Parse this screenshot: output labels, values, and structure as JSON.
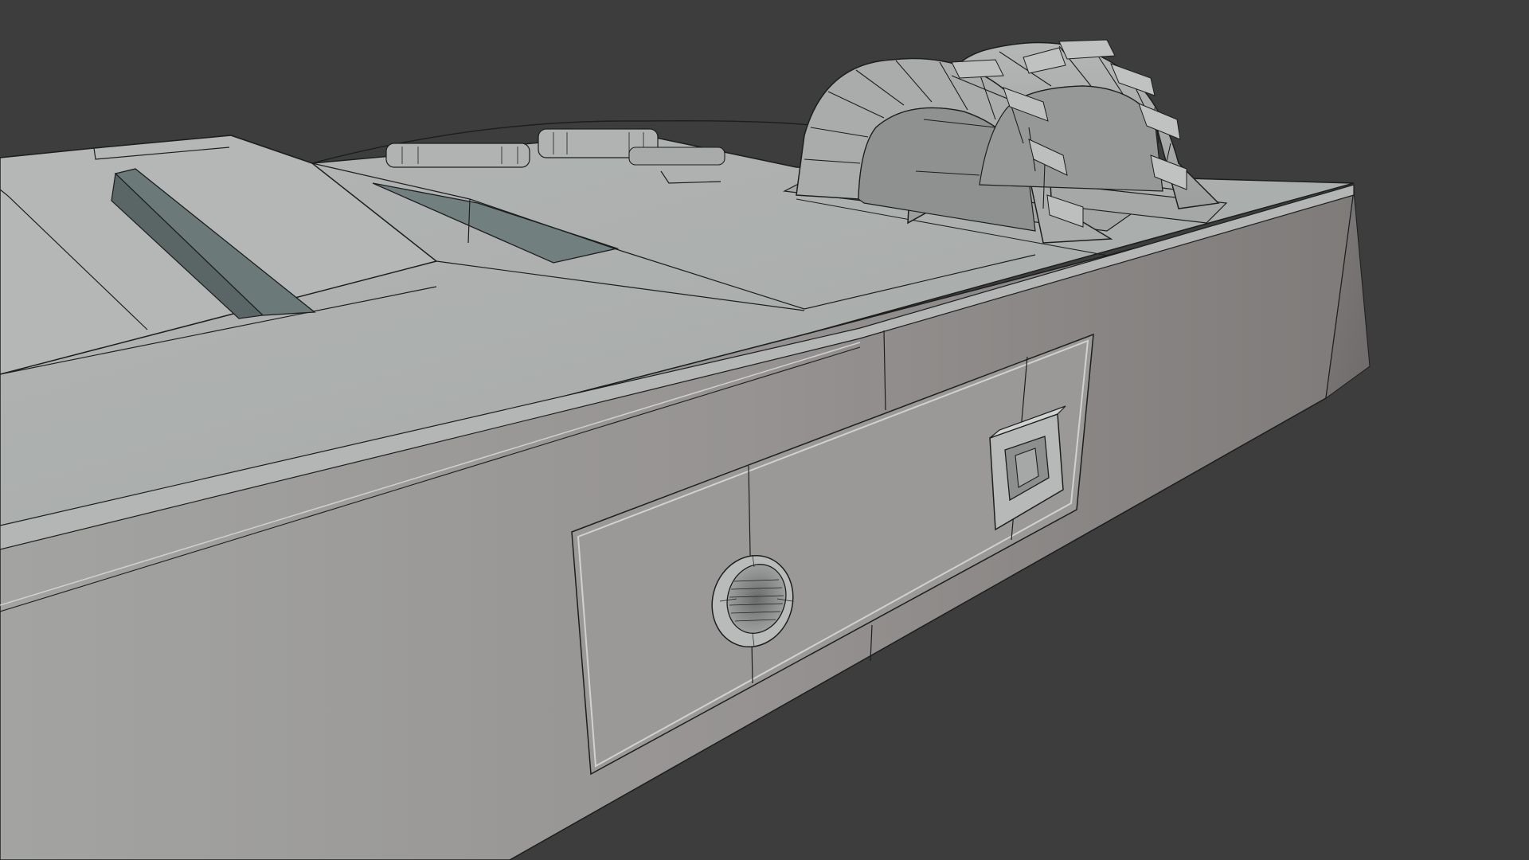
{
  "viewport": {
    "background_color": "#3d3d3d",
    "render_mode": "solid-shaded-with-wireframe"
  },
  "model": {
    "subject": "hard-surface-block",
    "surface_color": "#a9acaa",
    "edge_color": "#1a1c1c",
    "recess_color": "#6f7d7c",
    "features": [
      "top-deck-panels",
      "angled-slot-recess",
      "rounded-vents",
      "double-arch-handles",
      "side-panel",
      "round-port",
      "square-connector"
    ]
  }
}
